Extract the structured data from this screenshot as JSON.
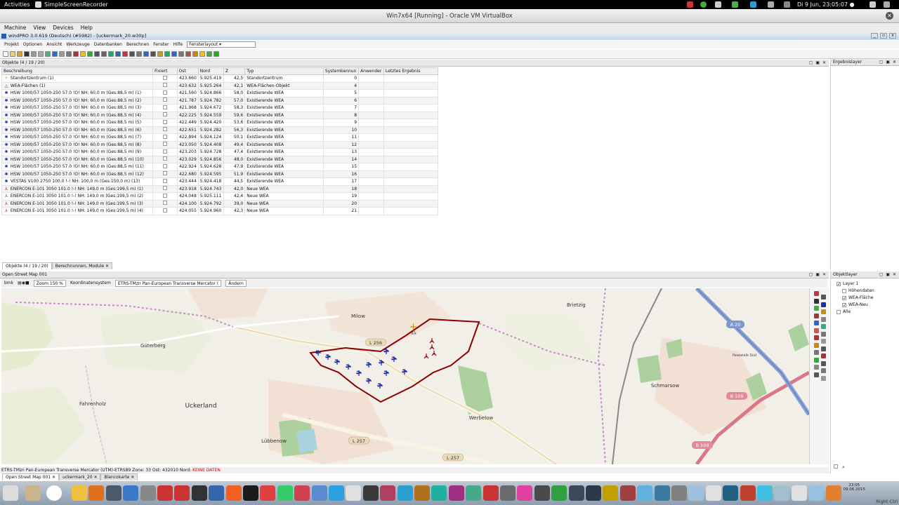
{
  "gnome": {
    "activities": "Activities",
    "app": "SimpleScreenRecorder",
    "clock": "Di  9 Jun, 23:05:07 ●"
  },
  "vbox": {
    "title": "Win7x64 [Running] - Oracle VM VirtualBox",
    "menu": [
      "Machine",
      "View",
      "Devices",
      "Help"
    ]
  },
  "windpro": {
    "title": "windPRO 3.0.619 (Deutsch) (#5982) - [uckermark_20.w30p]",
    "menu": [
      "Projekt",
      "Optionen",
      "Ansicht",
      "Werkzeuge",
      "Datenbanken",
      "Berechnen",
      "Fenster",
      "Hilfe"
    ],
    "layout_select": "Fensterlayout ▾"
  },
  "objects": {
    "header": "Objekte (4 / 19 / 20)",
    "columns": [
      "Beschreibung",
      "Fixiert",
      "Ost",
      "Nord",
      "Z",
      "Typ",
      "Systemkennun",
      "Anwender",
      "Letztes Ergebnis"
    ],
    "rows": [
      {
        "icon": "site-center",
        "desc": "Standortzentrum (1)",
        "ost": "423.660",
        "nord": "5.925.419",
        "z": "42,5",
        "typ": "Standortzentrum",
        "sys": "0"
      },
      {
        "icon": "area",
        "desc": "WEA-Flächen (1)",
        "ost": "423.632",
        "nord": "5.925.264",
        "z": "42,1",
        "typ": "WEA-Flächen-Objekt",
        "sys": "4"
      },
      {
        "icon": "existing",
        "desc": "HSW 1000/57 1050-250 57.0 !O! NH: 60,0 m (Ges:88,5 m) (1)",
        "ost": "421.560",
        "nord": "5.924.866",
        "z": "58,0",
        "typ": "Existierende WEA",
        "sys": "5"
      },
      {
        "icon": "existing",
        "desc": "HSW 1000/57 1050-250 57.0 !O! NH: 60,0 m (Ges:88,5 m) (2)",
        "ost": "421.787",
        "nord": "5.924.782",
        "z": "57,0",
        "typ": "Existierende WEA",
        "sys": "6"
      },
      {
        "icon": "existing",
        "desc": "HSW 1000/57 1050-250 57.0 !O! NH: 60,0 m (Ges:88,5 m) (3)",
        "ost": "421.968",
        "nord": "5.924.672",
        "z": "58,3",
        "typ": "Existierende WEA",
        "sys": "7"
      },
      {
        "icon": "existing",
        "desc": "HSW 1000/57 1050-250 57.0 !O! NH: 60,0 m (Ges:88,5 m) (4)",
        "ost": "422.225",
        "nord": "5.924.559",
        "z": "59,6",
        "typ": "Existierende WEA",
        "sys": "8"
      },
      {
        "icon": "existing",
        "desc": "HSW 1000/57 1050-250 57.0 !O! NH: 60,0 m (Ges:88,5 m) (5)",
        "ost": "422.449",
        "nord": "5.924.420",
        "z": "53,6",
        "typ": "Existierende WEA",
        "sys": "9"
      },
      {
        "icon": "existing",
        "desc": "HSW 1000/57 1050-250 57.0 !O! NH: 60,0 m (Ges:88,5 m) (6)",
        "ost": "422.651",
        "nord": "5.924.282",
        "z": "56,3",
        "typ": "Existierende WEA",
        "sys": "10"
      },
      {
        "icon": "existing",
        "desc": "HSW 1000/57 1050-250 57.0 !O! NH: 60,0 m (Ges:88,5 m) (7)",
        "ost": "422.894",
        "nord": "5.924.124",
        "z": "50,1",
        "typ": "Existierende WEA",
        "sys": "11"
      },
      {
        "icon": "existing",
        "desc": "HSW 1000/57 1050-250 57.0 !O! NH: 60,0 m (Ges:88,5 m) (8)",
        "ost": "423.050",
        "nord": "5.924.408",
        "z": "49,4",
        "typ": "Existierende WEA",
        "sys": "12"
      },
      {
        "icon": "existing",
        "desc": "HSW 1000/57 1050-250 57.0 !O! NH: 60,0 m (Ges:88,5 m) (9)",
        "ost": "423.203",
        "nord": "5.924.728",
        "z": "47,4",
        "typ": "Existierende WEA",
        "sys": "13"
      },
      {
        "icon": "existing",
        "desc": "HSW 1000/57 1050-250 57.0 !O! NH: 60,0 m (Ges:88,5 m) (10)",
        "ost": "423.029",
        "nord": "5.924.856",
        "z": "48,0",
        "typ": "Existierende WEA",
        "sys": "14"
      },
      {
        "icon": "existing",
        "desc": "HSW 1000/57 1050-250 57.0 !O! NH: 60,0 m (Ges:88,5 m) (11)",
        "ost": "422.924",
        "nord": "5.924.628",
        "z": "47,9",
        "typ": "Existierende WEA",
        "sys": "15"
      },
      {
        "icon": "existing",
        "desc": "HSW 1000/57 1050-250 57.0 !O! NH: 60,0 m (Ges:88,5 m) (12)",
        "ost": "422.680",
        "nord": "5.924.595",
        "z": "51,9",
        "typ": "Existierende WEA",
        "sys": "16"
      },
      {
        "icon": "existing",
        "desc": "VESTAS V100 2750 100.0 !-! NH: 100,0 m (Ges:150,0 m) (13)",
        "ost": "423.444",
        "nord": "5.924.418",
        "z": "44,5",
        "typ": "Existierende WEA",
        "sys": "17"
      },
      {
        "icon": "new",
        "desc": "ENERCON E-101 3050 101.0 !-! NH: 149,0 m (Ges:199,5 m) (1)",
        "ost": "423.918",
        "nord": "5.924.743",
        "z": "42,0",
        "typ": "Neue WEA",
        "sys": "18"
      },
      {
        "icon": "new",
        "desc": "ENERCON E-101 3050 101.0 !-! NH: 149,0 m (Ges:199,5 m) (2)",
        "ost": "424.048",
        "nord": "5.925.111",
        "z": "42,4",
        "typ": "Neue WEA",
        "sys": "19"
      },
      {
        "icon": "new",
        "desc": "ENERCON E-101 3050 101.0 !-! NH: 149,0 m (Ges:199,5 m) (3)",
        "ost": "424.100",
        "nord": "5.924.792",
        "z": "39,0",
        "typ": "Neue WEA",
        "sys": "20"
      },
      {
        "icon": "new",
        "desc": "ENERCON E-101 3050 101.0 !-! NH: 149,0 m (Ges:199,5 m) (4)",
        "ost": "424.055",
        "nord": "5.924.960",
        "z": "42,3",
        "typ": "Neue WEA",
        "sys": "21"
      }
    ],
    "tabs": [
      "Objekte (4 / 19 / 20)",
      "Berechnunnen, Module"
    ]
  },
  "map": {
    "header": "Open Street Map 001",
    "bmk": "bmk",
    "zoom": "Zoom 150 %",
    "coord_label": "Koordinatensystem",
    "coord": "ETRS-TMzn Pan-European Transverse Mercator (",
    "change": "Ändern",
    "places": [
      "Milow",
      "Brietzig",
      "Güterberg",
      "Uckerland",
      "Fahrenholz",
      "Schmarsow",
      "Werbelow",
      "Lübbenow",
      "Pasewalk-Süd"
    ],
    "roads": [
      "L 256",
      "A 20",
      "B 109",
      "L 257",
      "B 109",
      "L 257"
    ],
    "status": "ETRS-TMzn Pan-European Transverse Mercator (UTM)-ETRS89 Zone: 33  Ost: 432010  Nord:",
    "status_nd": "KEINE DATEN",
    "tabs": [
      "Open Street Map 001",
      "uckermark_20",
      "Blancokarte"
    ]
  },
  "right": {
    "ergeb": "Ergebnislayer",
    "obj": "Objektlayer",
    "layers": [
      {
        "name": "Layer 1",
        "checked": true
      },
      {
        "name": "Höhendaten",
        "checked": false
      },
      {
        "name": "WEA-Fläche",
        "checked": true
      },
      {
        "name": "WEA-Neu",
        "checked": true
      },
      {
        "name": "Alle",
        "checked": false
      }
    ]
  },
  "taskbar": {
    "time": "23:05",
    "date": "09.06.2015",
    "rightctrl": "Right Ctrl"
  }
}
